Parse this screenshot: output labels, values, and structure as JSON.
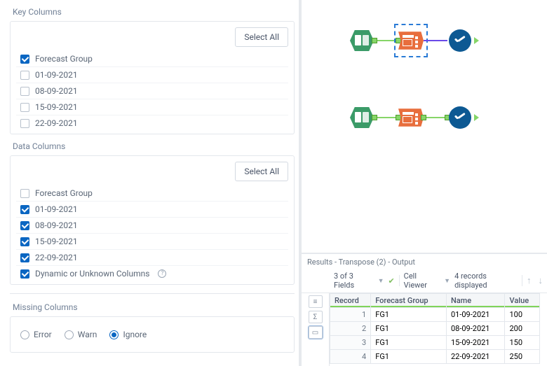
{
  "sections": {
    "key": {
      "title": "Key Columns",
      "select_all": "Select All"
    },
    "data": {
      "title": "Data Columns",
      "select_all": "Select All"
    },
    "missing": {
      "title": "Missing Columns"
    }
  },
  "key_items": [
    {
      "label": "Forecast Group",
      "checked": true
    },
    {
      "label": "01-09-2021",
      "checked": false
    },
    {
      "label": "08-09-2021",
      "checked": false
    },
    {
      "label": "15-09-2021",
      "checked": false
    },
    {
      "label": "22-09-2021",
      "checked": false
    }
  ],
  "data_items": [
    {
      "label": "Forecast Group",
      "checked": false
    },
    {
      "label": "01-09-2021",
      "checked": true
    },
    {
      "label": "08-09-2021",
      "checked": true
    },
    {
      "label": "15-09-2021",
      "checked": true
    },
    {
      "label": "22-09-2021",
      "checked": true
    },
    {
      "label": "Dynamic or Unknown Columns",
      "checked": true,
      "info": true
    }
  ],
  "missing_options": [
    {
      "label": "Error",
      "sel": false
    },
    {
      "label": "Warn",
      "sel": false
    },
    {
      "label": "Ignore",
      "sel": true
    }
  ],
  "results": {
    "title": "Results - Transpose (2) - Output",
    "fields_text": "3 of 3 Fields",
    "viewer": "Cell Viewer",
    "records": "4 records displayed",
    "headers": {
      "record": "Record",
      "group": "Forecast Group",
      "name": "Name",
      "value": "Value"
    },
    "rows": [
      {
        "record": "1",
        "group": "FG1",
        "name": "01-09-2021",
        "value": "100"
      },
      {
        "record": "2",
        "group": "FG1",
        "name": "08-09-2021",
        "value": "200"
      },
      {
        "record": "3",
        "group": "FG1",
        "name": "15-09-2021",
        "value": "150"
      },
      {
        "record": "4",
        "group": "FG1",
        "name": "22-09-2021",
        "value": "250"
      }
    ]
  },
  "icons": {
    "green": "#3b9b68",
    "orange": "#e86e3d",
    "navy": "#0d5993"
  }
}
